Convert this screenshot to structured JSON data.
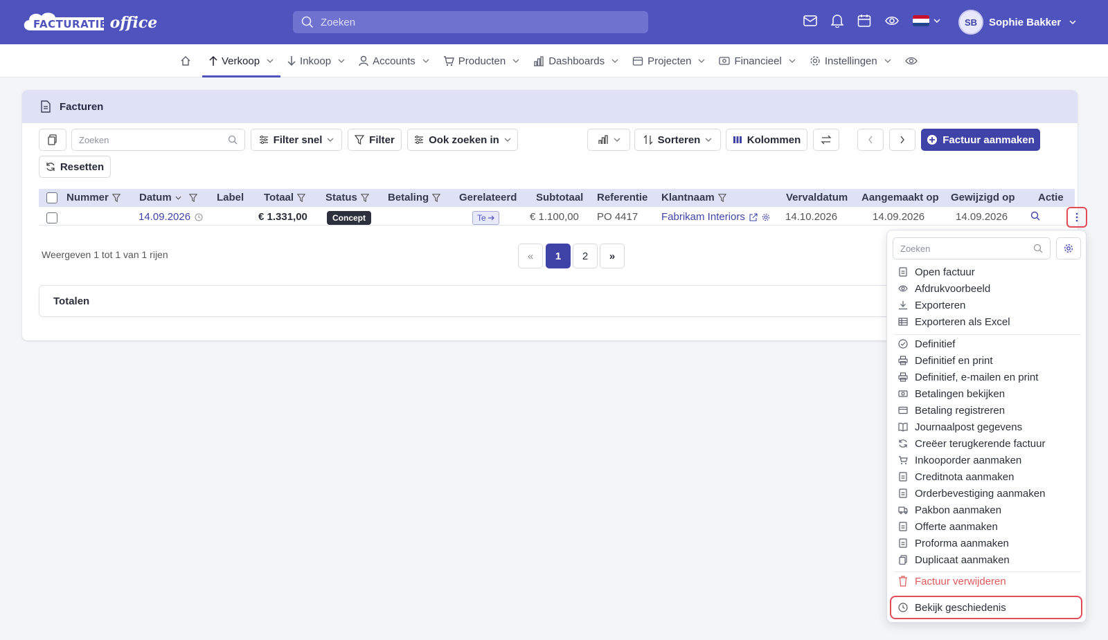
{
  "app": {
    "logo_text_1": "FACTURATIE",
    "logo_text_2": "office",
    "search_placeholder": "Zoeken",
    "user": {
      "initials": "SB",
      "name": "Sophie Bakker"
    }
  },
  "nav": {
    "items": [
      {
        "label": "Verkoop",
        "icon": "arrow-up-icon",
        "active": true
      },
      {
        "label": "Inkoop",
        "icon": "arrow-down-icon"
      },
      {
        "label": "Accounts",
        "icon": "user-icon"
      },
      {
        "label": "Producten",
        "icon": "cart-icon"
      },
      {
        "label": "Dashboards",
        "icon": "bar-chart-icon"
      },
      {
        "label": "Projecten",
        "icon": "calendar-icon"
      },
      {
        "label": "Financieel",
        "icon": "money-icon"
      },
      {
        "label": "Instellingen",
        "icon": "gear-icon"
      }
    ]
  },
  "page": {
    "title": "Facturen",
    "search_placeholder": "Zoeken",
    "filter_snel": "Filter snel",
    "filter": "Filter",
    "ook_zoeken": "Ook zoeken in",
    "sorteren": "Sorteren",
    "kolommen": "Kolommen",
    "create": "Factuur aanmaken",
    "reset": "Resetten"
  },
  "table": {
    "headers": {
      "nummer": "Nummer",
      "datum": "Datum",
      "label": "Label",
      "totaal": "Totaal",
      "status": "Status",
      "betaling": "Betaling",
      "gerelateerd": "Gerelateerd",
      "subtotaal": "Subtotaal",
      "referentie": "Referentie",
      "klantnaam": "Klantnaam",
      "vervaldatum": "Vervaldatum",
      "aangemaakt": "Aangemaakt op",
      "gewijzigd": "Gewijzigd op",
      "actie": "Actie"
    },
    "row": {
      "datum": "14.09.2026",
      "totaal": "€ 1.331,00",
      "status": "Concept",
      "gerelateerd": "Te",
      "subtotaal": "€ 1.100,00",
      "referentie": "PO 4417",
      "klantnaam": "Fabrikam Interiors",
      "vervaldatum": "14.10.2026",
      "aangemaakt": "14.09.2026",
      "gewijzigd": "14.09.2026"
    },
    "summary": "Weergeven 1 tot 1 van 1 rijen",
    "pages": {
      "first": "«",
      "p1": "1",
      "p2": "2",
      "next": "»"
    },
    "totals": "Totalen"
  },
  "menu": {
    "search_placeholder": "Zoeken",
    "group1": [
      "Open factuur",
      "Afdrukvoorbeeld",
      "Exporteren",
      "Exporteren als Excel"
    ],
    "group2": [
      "Definitief",
      "Definitief en print",
      "Definitief, e-mailen en print",
      "Betalingen bekijken",
      "Betaling registreren",
      "Journaalpost gegevens",
      "Creëer terugkerende factuur",
      "Inkooporder aanmaken",
      "Creditnota aanmaken",
      "Orderbevestiging aanmaken",
      "Pakbon aanmaken",
      "Offerte aanmaken",
      "Proforma aanmaken",
      "Duplicaat aanmaken"
    ],
    "delete": "Factuur verwijderen",
    "history": "Bekijk geschiedenis"
  },
  "colors": {
    "brand": "#4f53be",
    "primary": "#3f43a8",
    "danger": "#e0595a"
  }
}
